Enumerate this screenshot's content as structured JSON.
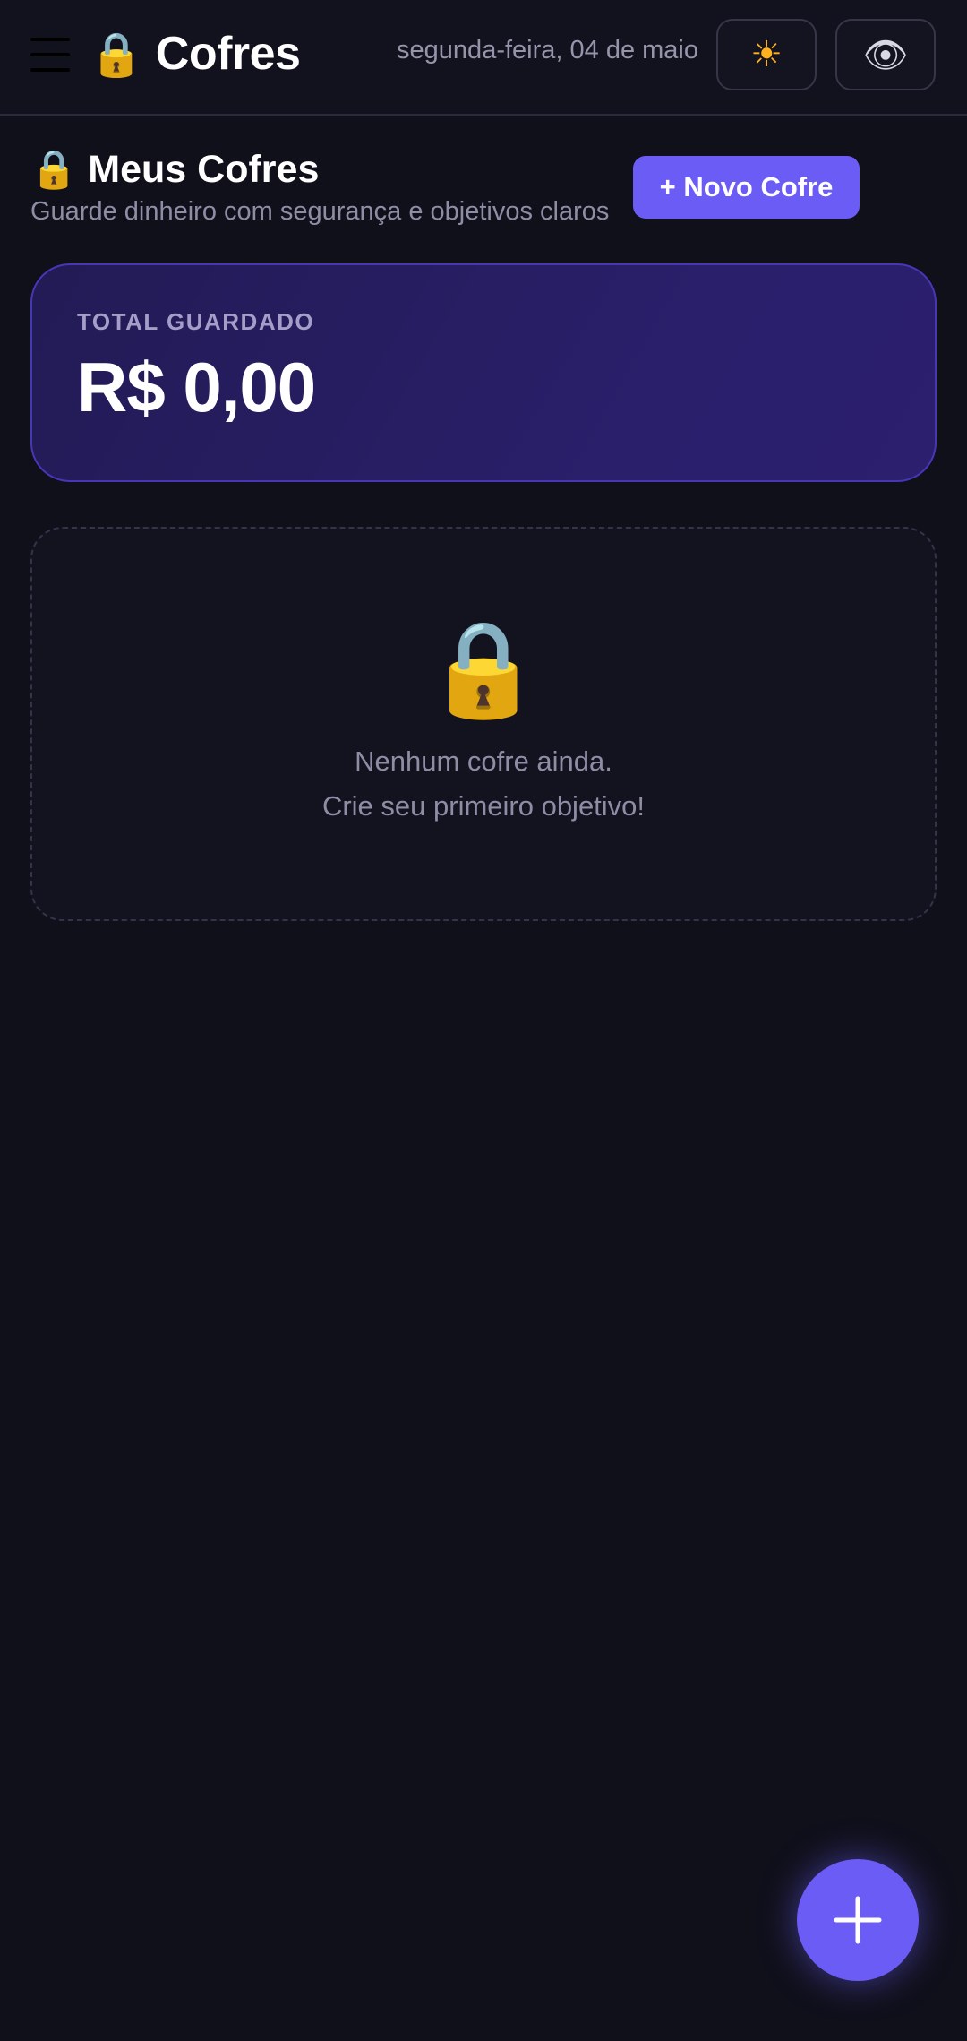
{
  "header": {
    "lock_emoji": "🔒",
    "title": "Cofres",
    "date": "segunda-feira, 04 de maio",
    "theme_icon": "☀",
    "eye_icon": "👁"
  },
  "section": {
    "lock_emoji": "🔒",
    "title": "Meus Cofres",
    "subtitle": "Guarde dinheiro com segurança e objetivos claros",
    "new_button_label": "+ Novo Cofre"
  },
  "total": {
    "label": "TOTAL GUARDADO",
    "value": "R$ 0,00"
  },
  "empty_state": {
    "icon": "🔒",
    "line1": "Nenhum cofre ainda.",
    "line2": "Crie seu primeiro objetivo!"
  },
  "icons": {
    "menu": "hamburger-icon",
    "theme": "sun-icon",
    "visibility": "eye-icon",
    "fab": "plus-icon"
  },
  "colors": {
    "background": "#10101b",
    "accent": "#6c5cf6",
    "card_gradient_start": "#221b55",
    "card_gradient_end": "#2b1f6e",
    "muted_text": "#8d8da6"
  }
}
